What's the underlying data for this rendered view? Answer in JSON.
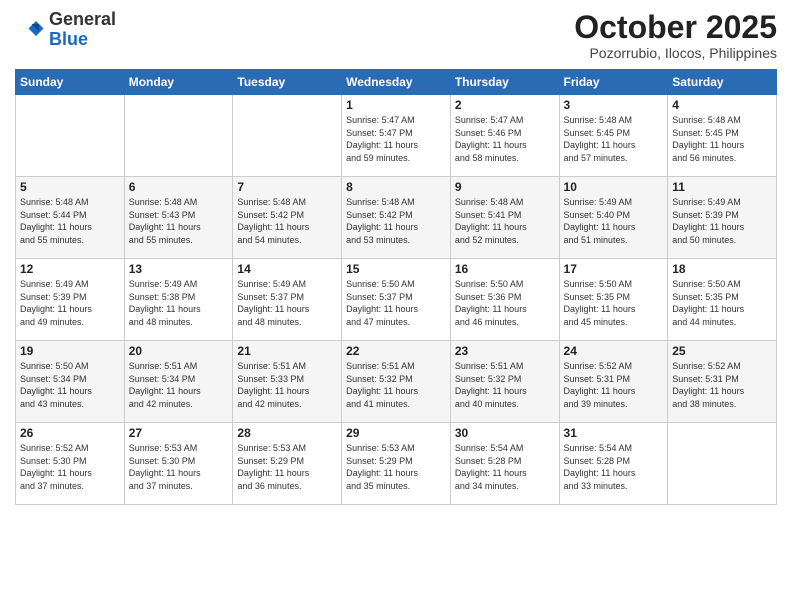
{
  "header": {
    "logo": {
      "line1": "General",
      "line2": "Blue"
    },
    "title": "October 2025",
    "location": "Pozorrubio, Ilocos, Philippines"
  },
  "weekdays": [
    "Sunday",
    "Monday",
    "Tuesday",
    "Wednesday",
    "Thursday",
    "Friday",
    "Saturday"
  ],
  "weeks": [
    [
      {
        "day": "",
        "info": ""
      },
      {
        "day": "",
        "info": ""
      },
      {
        "day": "",
        "info": ""
      },
      {
        "day": "1",
        "info": "Sunrise: 5:47 AM\nSunset: 5:47 PM\nDaylight: 11 hours\nand 59 minutes."
      },
      {
        "day": "2",
        "info": "Sunrise: 5:47 AM\nSunset: 5:46 PM\nDaylight: 11 hours\nand 58 minutes."
      },
      {
        "day": "3",
        "info": "Sunrise: 5:48 AM\nSunset: 5:45 PM\nDaylight: 11 hours\nand 57 minutes."
      },
      {
        "day": "4",
        "info": "Sunrise: 5:48 AM\nSunset: 5:45 PM\nDaylight: 11 hours\nand 56 minutes."
      }
    ],
    [
      {
        "day": "5",
        "info": "Sunrise: 5:48 AM\nSunset: 5:44 PM\nDaylight: 11 hours\nand 55 minutes."
      },
      {
        "day": "6",
        "info": "Sunrise: 5:48 AM\nSunset: 5:43 PM\nDaylight: 11 hours\nand 55 minutes."
      },
      {
        "day": "7",
        "info": "Sunrise: 5:48 AM\nSunset: 5:42 PM\nDaylight: 11 hours\nand 54 minutes."
      },
      {
        "day": "8",
        "info": "Sunrise: 5:48 AM\nSunset: 5:42 PM\nDaylight: 11 hours\nand 53 minutes."
      },
      {
        "day": "9",
        "info": "Sunrise: 5:48 AM\nSunset: 5:41 PM\nDaylight: 11 hours\nand 52 minutes."
      },
      {
        "day": "10",
        "info": "Sunrise: 5:49 AM\nSunset: 5:40 PM\nDaylight: 11 hours\nand 51 minutes."
      },
      {
        "day": "11",
        "info": "Sunrise: 5:49 AM\nSunset: 5:39 PM\nDaylight: 11 hours\nand 50 minutes."
      }
    ],
    [
      {
        "day": "12",
        "info": "Sunrise: 5:49 AM\nSunset: 5:39 PM\nDaylight: 11 hours\nand 49 minutes."
      },
      {
        "day": "13",
        "info": "Sunrise: 5:49 AM\nSunset: 5:38 PM\nDaylight: 11 hours\nand 48 minutes."
      },
      {
        "day": "14",
        "info": "Sunrise: 5:49 AM\nSunset: 5:37 PM\nDaylight: 11 hours\nand 48 minutes."
      },
      {
        "day": "15",
        "info": "Sunrise: 5:50 AM\nSunset: 5:37 PM\nDaylight: 11 hours\nand 47 minutes."
      },
      {
        "day": "16",
        "info": "Sunrise: 5:50 AM\nSunset: 5:36 PM\nDaylight: 11 hours\nand 46 minutes."
      },
      {
        "day": "17",
        "info": "Sunrise: 5:50 AM\nSunset: 5:35 PM\nDaylight: 11 hours\nand 45 minutes."
      },
      {
        "day": "18",
        "info": "Sunrise: 5:50 AM\nSunset: 5:35 PM\nDaylight: 11 hours\nand 44 minutes."
      }
    ],
    [
      {
        "day": "19",
        "info": "Sunrise: 5:50 AM\nSunset: 5:34 PM\nDaylight: 11 hours\nand 43 minutes."
      },
      {
        "day": "20",
        "info": "Sunrise: 5:51 AM\nSunset: 5:34 PM\nDaylight: 11 hours\nand 42 minutes."
      },
      {
        "day": "21",
        "info": "Sunrise: 5:51 AM\nSunset: 5:33 PM\nDaylight: 11 hours\nand 42 minutes."
      },
      {
        "day": "22",
        "info": "Sunrise: 5:51 AM\nSunset: 5:32 PM\nDaylight: 11 hours\nand 41 minutes."
      },
      {
        "day": "23",
        "info": "Sunrise: 5:51 AM\nSunset: 5:32 PM\nDaylight: 11 hours\nand 40 minutes."
      },
      {
        "day": "24",
        "info": "Sunrise: 5:52 AM\nSunset: 5:31 PM\nDaylight: 11 hours\nand 39 minutes."
      },
      {
        "day": "25",
        "info": "Sunrise: 5:52 AM\nSunset: 5:31 PM\nDaylight: 11 hours\nand 38 minutes."
      }
    ],
    [
      {
        "day": "26",
        "info": "Sunrise: 5:52 AM\nSunset: 5:30 PM\nDaylight: 11 hours\nand 37 minutes."
      },
      {
        "day": "27",
        "info": "Sunrise: 5:53 AM\nSunset: 5:30 PM\nDaylight: 11 hours\nand 37 minutes."
      },
      {
        "day": "28",
        "info": "Sunrise: 5:53 AM\nSunset: 5:29 PM\nDaylight: 11 hours\nand 36 minutes."
      },
      {
        "day": "29",
        "info": "Sunrise: 5:53 AM\nSunset: 5:29 PM\nDaylight: 11 hours\nand 35 minutes."
      },
      {
        "day": "30",
        "info": "Sunrise: 5:54 AM\nSunset: 5:28 PM\nDaylight: 11 hours\nand 34 minutes."
      },
      {
        "day": "31",
        "info": "Sunrise: 5:54 AM\nSunset: 5:28 PM\nDaylight: 11 hours\nand 33 minutes."
      },
      {
        "day": "",
        "info": ""
      }
    ]
  ]
}
